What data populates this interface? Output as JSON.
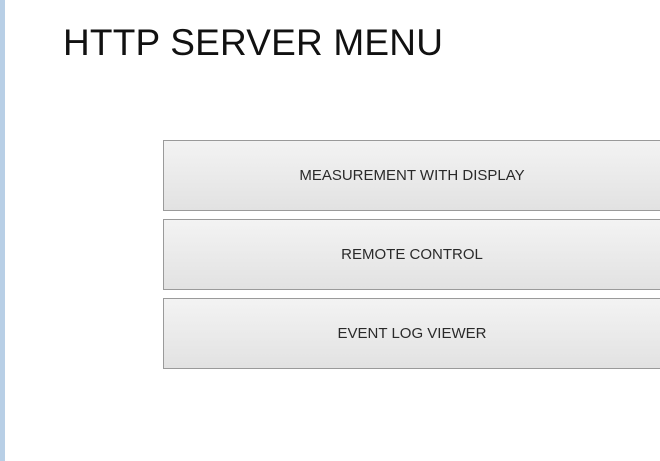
{
  "page": {
    "title": "HTTP SERVER MENU"
  },
  "menu": {
    "items": [
      {
        "label": "MEASUREMENT WITH DISPLAY"
      },
      {
        "label": "REMOTE CONTROL"
      },
      {
        "label": "EVENT LOG VIEWER"
      }
    ]
  },
  "colors": {
    "accent_bar": "#b8cfe6",
    "button_border": "#9a9a9a",
    "button_fill": "#e9e9e9"
  }
}
